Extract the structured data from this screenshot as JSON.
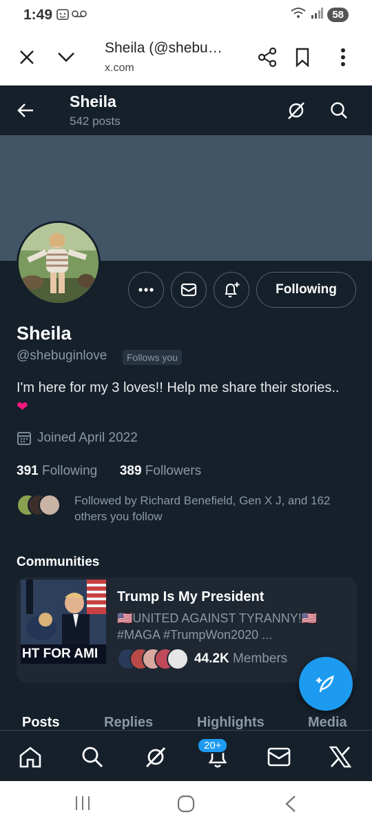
{
  "status_bar": {
    "time": "1:49",
    "battery": "58"
  },
  "browser": {
    "title": "Sheila (@shebu…",
    "url": "x.com"
  },
  "header": {
    "name": "Sheila",
    "posts": "542 posts"
  },
  "profile": {
    "display_name": "Sheila",
    "handle": "@shebuginlove",
    "follows_you": "Follows you",
    "bio": "I'm here for my 3 loves!! Help me share their stories..",
    "bio_emoji": "❤",
    "joined": "Joined April 2022",
    "following_count": "391",
    "following_label": "Following",
    "followers_count": "389",
    "followers_label": "Followers",
    "followed_by": "Followed by Richard Benefield, Gen X J, and 162 others you follow",
    "following_button": "Following"
  },
  "communities": {
    "title": "Communities",
    "card": {
      "name": "Trump Is My President",
      "description": "🇺🇸UNITED AGAINST TYRANNY!🇺🇸 #MAGA #TrumpWon2020 ...",
      "image_text": "HT FOR AMI",
      "members_count": "44.2K",
      "members_label": "Members"
    }
  },
  "tabs": [
    "Posts",
    "Replies",
    "Highlights",
    "Media"
  ],
  "bottom_nav": {
    "notifications_badge": "20+"
  },
  "colors": {
    "background": "#15202b",
    "banner": "#425566",
    "accent": "#1d9bf0",
    "muted": "#8b98a5"
  }
}
